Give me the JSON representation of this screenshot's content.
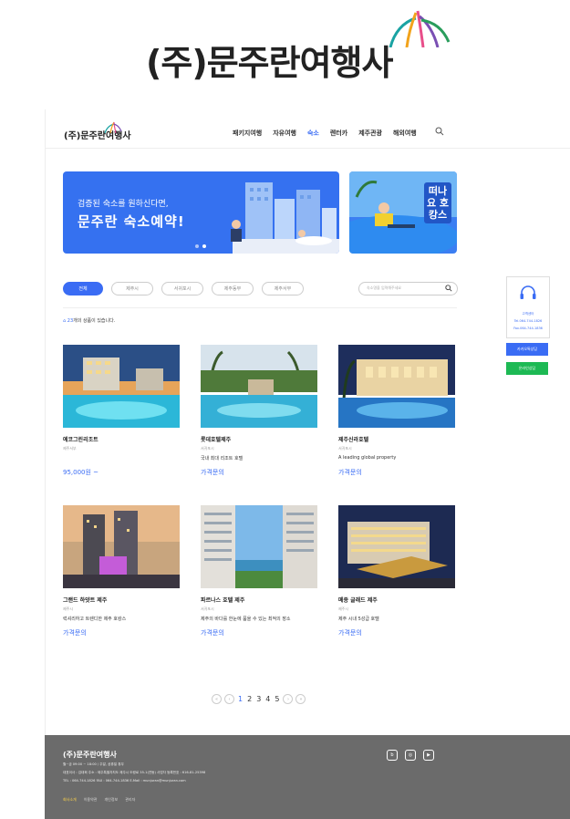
{
  "brand": {
    "name": "(주)문주란여행사"
  },
  "nav": {
    "logo": "(주)문주란여행사",
    "items": [
      "패키지여행",
      "자유여행",
      "숙소",
      "렌터카",
      "제주관광",
      "해외여행"
    ],
    "active_index": 2
  },
  "banner": {
    "subtitle": "검증된 숙소를 원하신다면,",
    "title": "문주란 숙소예약!",
    "side_text": "떠나요 호캉스"
  },
  "filters": {
    "chips": [
      "전체",
      "제주시",
      "서귀포시",
      "제주동부",
      "제주서부"
    ],
    "active_index": 0,
    "search_placeholder": "숙소명을 입력해주세요"
  },
  "result_count": {
    "number": "23",
    "text": "개의 상품이 있습니다."
  },
  "cards": [
    {
      "title": "에코그린리조트",
      "region": "제주서부",
      "desc": "",
      "price": "95,000원 ~"
    },
    {
      "title": "롯데호텔제주",
      "region": "서귀포시",
      "desc": "국내 최대 리조트 호텔",
      "price": "가격문의"
    },
    {
      "title": "제주신라호텔",
      "region": "서귀포시",
      "desc": "A leading global property",
      "price": "가격문의"
    },
    {
      "title": "그랜드 하얏트 제주",
      "region": "제주시",
      "desc": "럭셔리하고 트렌디한 제주 호캉스",
      "price": "가격문의"
    },
    {
      "title": "파르나스 호텔 제주",
      "region": "서귀포시",
      "desc": "제주의 바다를 한눈에 품을 수 있는 최적의 장소",
      "price": "가격문의"
    },
    {
      "title": "메종 글래드 제주",
      "region": "제주시",
      "desc": "제주 시내 5성급 호텔",
      "price": "가격문의"
    }
  ],
  "pagination": {
    "prev": [
      "«",
      "‹"
    ],
    "pages": [
      "1",
      "2",
      "3",
      "4",
      "5"
    ],
    "current": "1",
    "next": [
      "›",
      "»"
    ]
  },
  "side_widget": {
    "label": "고객센터",
    "tel": "Tel.064-744-1826",
    "fax": "Fax.064-744-1836",
    "btn_reserve": "카카오톡상담",
    "btn_chat": "온라인상담"
  },
  "footer": {
    "brand": "(주)문주란여행사",
    "hours": "월~금 09:00 ~ 18:00 / 주말, 공휴일 휴무",
    "line1": "대표이사 : 김대희   주소 : 제주특별자치도 제주시 도령로 35-1(연동)   사업자 등록번호 : 616-81-25398",
    "line2": "TEL : 064-744-1826   FAX : 064-744-1836   E-Mail : munjuran@munjuran.com",
    "links": [
      "회사소개",
      "이용약관",
      "개인정보",
      "관리자"
    ],
    "icons": [
      "blog-icon",
      "instagram-icon",
      "youtube-icon"
    ]
  },
  "colors": {
    "accent": "#3a6cf4",
    "footer_bg": "#6b6b6b",
    "chat_green": "#1db954"
  }
}
